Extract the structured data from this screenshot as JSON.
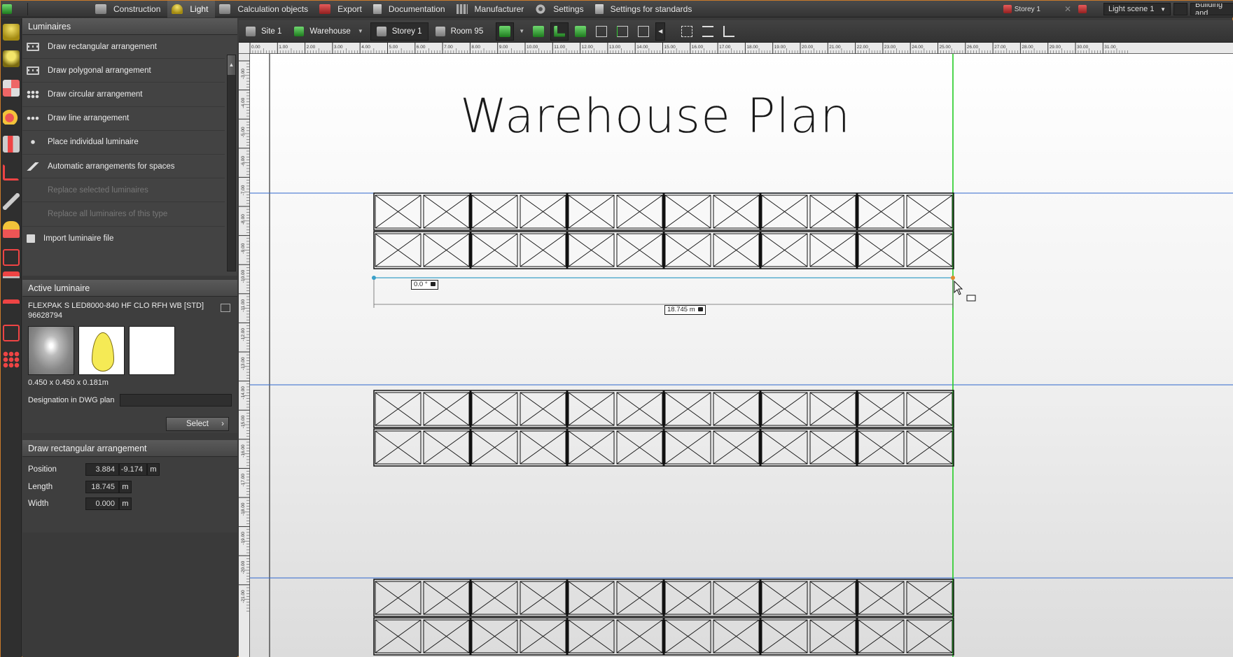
{
  "menu": {
    "items": [
      {
        "label": "Construction",
        "icon": "construction-icon"
      },
      {
        "label": "Light",
        "icon": "light-icon",
        "active": true
      },
      {
        "label": "Calculation objects",
        "icon": "calculation-icon"
      },
      {
        "label": "Export",
        "icon": "export-icon"
      },
      {
        "label": "Documentation",
        "icon": "documentation-icon"
      },
      {
        "label": "Manufacturer",
        "icon": "manufacturer-icon"
      },
      {
        "label": "Settings",
        "icon": "settings-gear-icon"
      },
      {
        "label": "Settings for standards",
        "icon": "standards-icon"
      }
    ],
    "storey": "Storey 1",
    "light_scene": "Light scene 1",
    "building": "Building and"
  },
  "luminaires": {
    "title": "Luminaires",
    "items": [
      {
        "label": "Draw rectangular arrangement",
        "enabled": true
      },
      {
        "label": "Draw polygonal arrangement",
        "enabled": true
      },
      {
        "label": "Draw circular arrangement",
        "enabled": true
      },
      {
        "label": "Draw line arrangement",
        "enabled": true
      },
      {
        "label": "Place individual luminaire",
        "enabled": true
      },
      {
        "label": "Automatic arrangements for spaces",
        "enabled": true
      },
      {
        "label": "Replace selected luminaires",
        "enabled": false
      },
      {
        "label": "Replace all luminaires of this type",
        "enabled": false
      },
      {
        "label": "Import luminaire file",
        "enabled": true
      }
    ]
  },
  "active_luminaire": {
    "title": "Active luminaire",
    "name": "FLEXPAK S LED8000-840 HF CLO RFH WB [STD]",
    "code": "96628794",
    "dimensions": "0.450 x 0.450 x 0.181m",
    "designation_label": "Designation in DWG plan",
    "designation_value": "",
    "select_label": "Select"
  },
  "arrangement": {
    "title": "Draw rectangular arrangement",
    "position_label": "Position",
    "position_x": "3.884",
    "position_y": "-9.174",
    "length_label": "Length",
    "length_value": "18.745",
    "width_label": "Width",
    "width_value": "0.000",
    "unit": "m"
  },
  "viewbar": {
    "site": "Site 1",
    "building": "Warehouse",
    "storey": "Storey 1",
    "room": "Room 95"
  },
  "canvas": {
    "title": "Warehouse Plan",
    "angle_label": "0.0 °",
    "length_label": "18.745 m",
    "ruler_top": [
      "0.00",
      "1.00",
      "2.00",
      "3.00",
      "4.00",
      "5.00",
      "6.00",
      "7.00",
      "8.00",
      "9.00",
      "10.00",
      "11.00",
      "12.00",
      "13.00",
      "14.00",
      "15.00",
      "16.00",
      "17.00",
      "18.00",
      "19.00",
      "20.00",
      "21.00",
      "22.00",
      "23.00",
      "24.00",
      "25.00",
      "26.00",
      "27.00",
      "28.00",
      "29.00",
      "30.00",
      "31.00"
    ],
    "ruler_left": [
      "-3.00",
      "-4.00",
      "-5.00",
      "-6.00",
      "-7.00",
      "-8.00",
      "-9.00",
      "-10.00",
      "-11.00",
      "-12.00",
      "-13.00",
      "-14.00",
      "-15.00",
      "-16.00",
      "-17.00",
      "-18.00",
      "-19.00",
      "-20.00",
      "-21.00"
    ]
  },
  "colors": {
    "accent_border": "#c97a2a",
    "guide_blue": "#3b6fd0",
    "guide_green": "#22cc22"
  }
}
